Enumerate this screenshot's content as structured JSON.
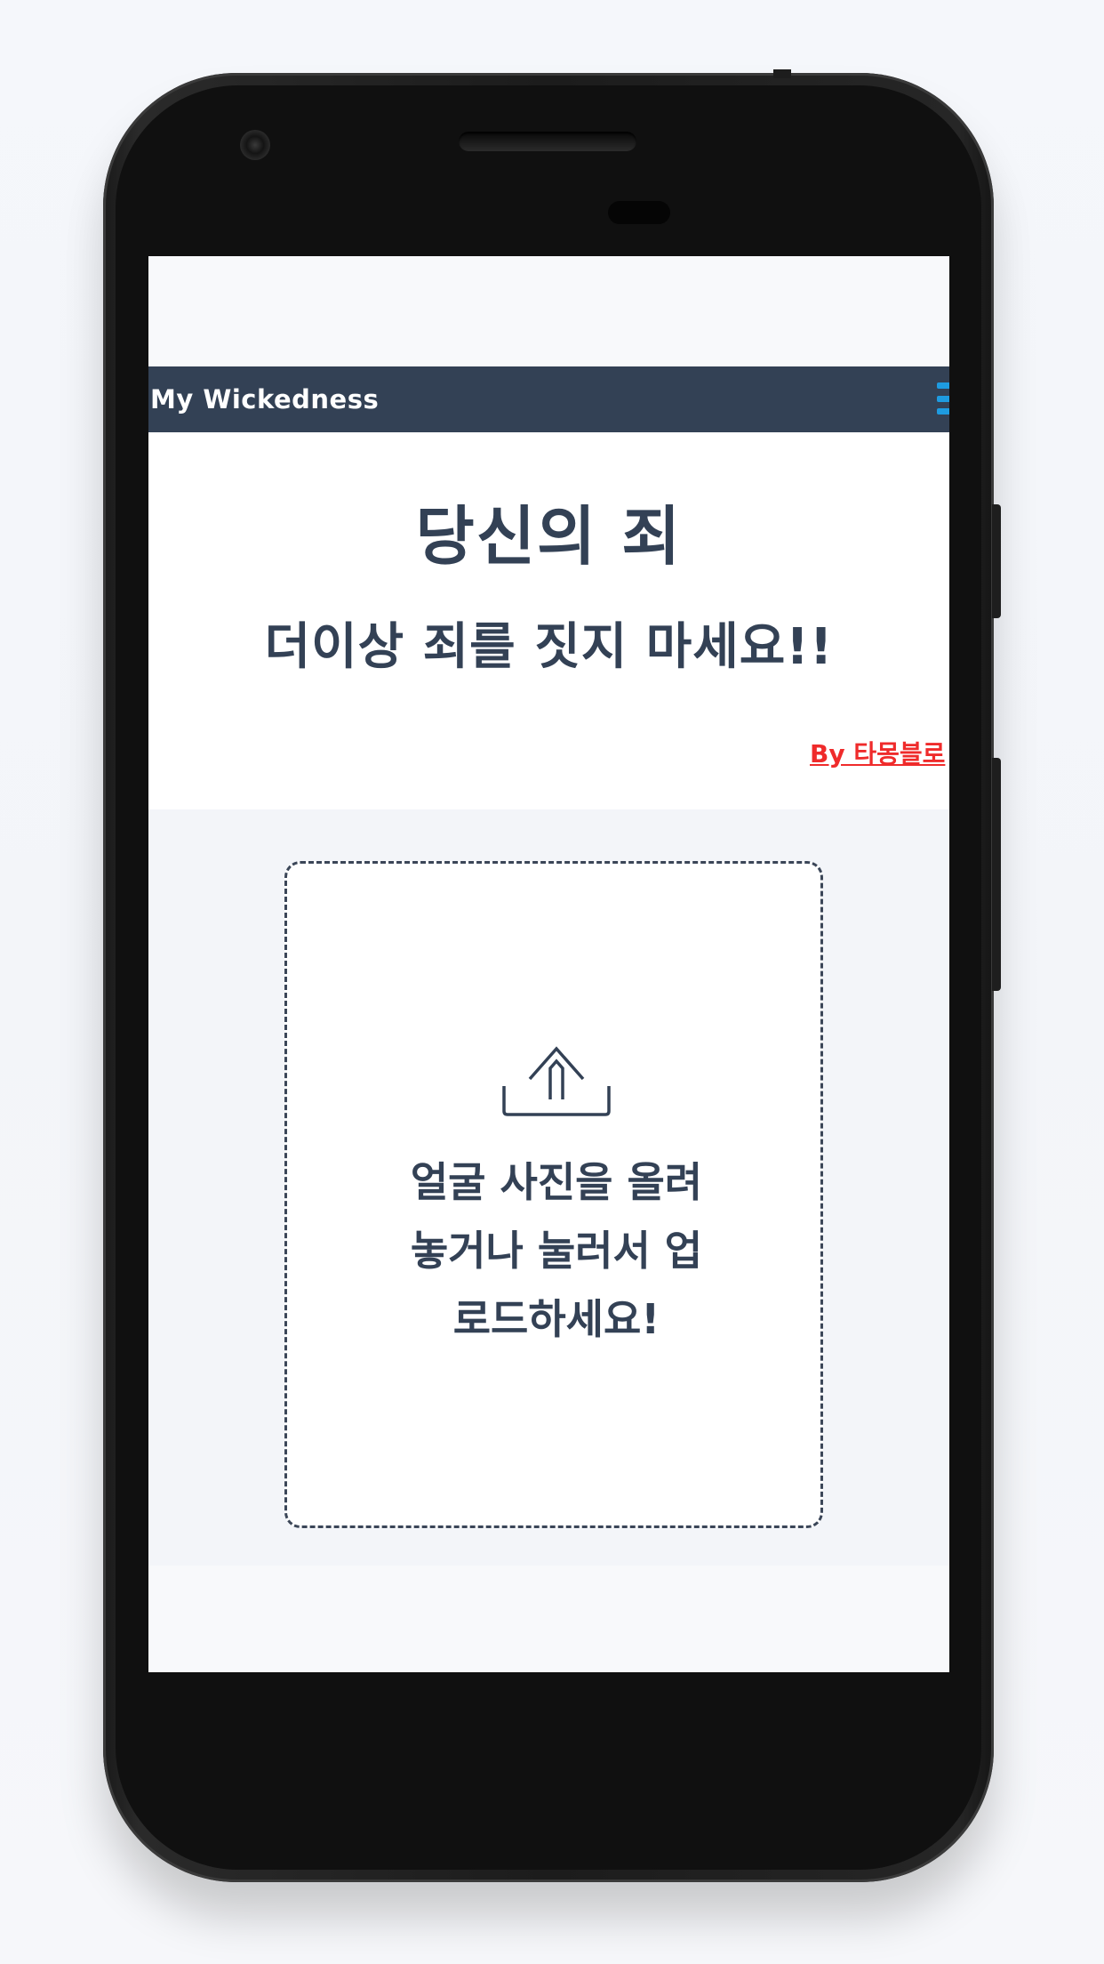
{
  "app": {
    "brand": "My Wickedness"
  },
  "hero": {
    "title": "당신의 죄",
    "subtitle": "더이상 죄를 짓지 마세요!!",
    "byline": "By 타몽블로"
  },
  "upload": {
    "instruction": "얼굴 사진을 올려놓거나 눌러서 업로드하세요!",
    "icon": "upload-icon"
  },
  "colors": {
    "navbar": "#334155",
    "text": "#334155",
    "byline": "#ef2b2b",
    "menu_icon": "#1e9be0"
  }
}
